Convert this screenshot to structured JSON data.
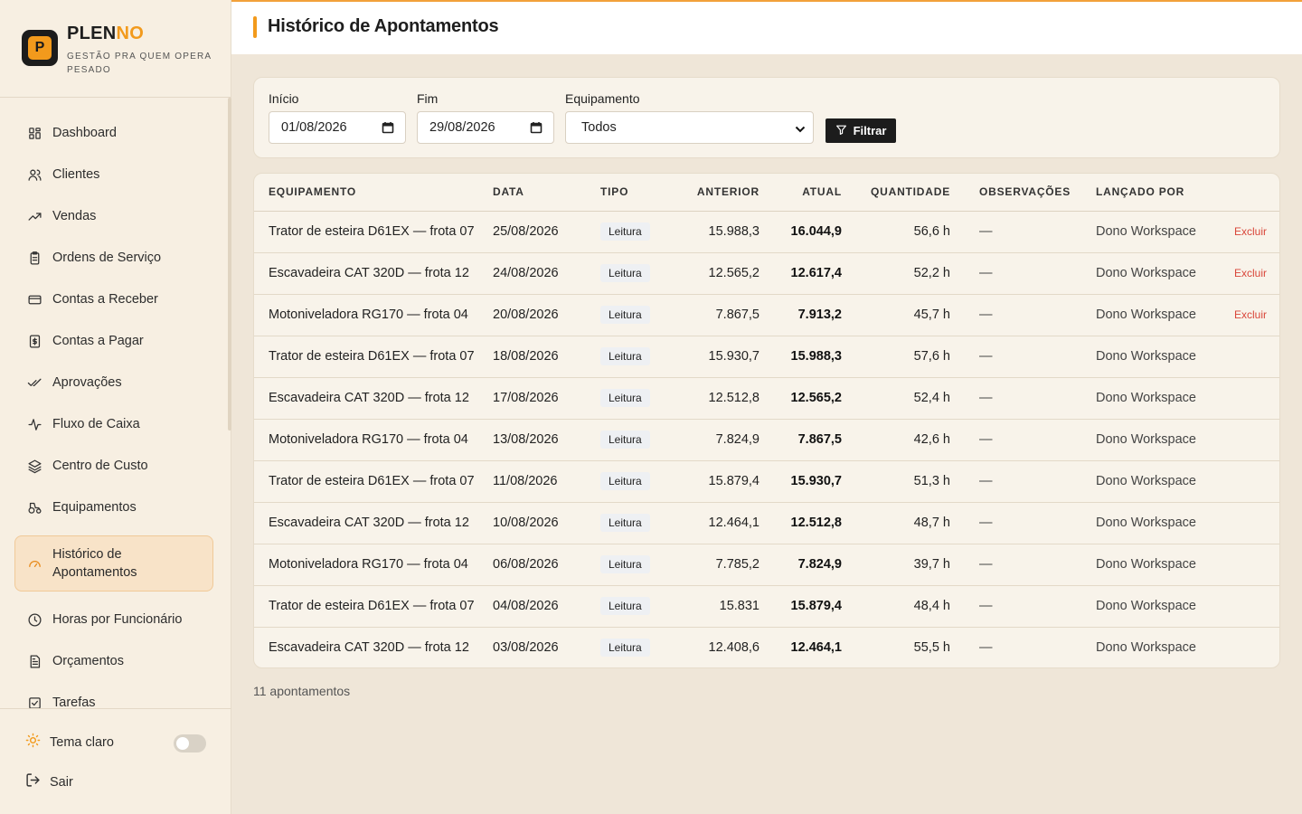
{
  "brand": {
    "logo_letter": "P",
    "name_a": "PLEN",
    "name_b": "NO",
    "tagline": "GESTÃO PRA QUEM OPERA PESADO"
  },
  "nav": [
    {
      "label": "Dashboard",
      "icon": "grid-icon"
    },
    {
      "label": "Clientes",
      "icon": "users-icon"
    },
    {
      "label": "Vendas",
      "icon": "trending-up-icon"
    },
    {
      "label": "Ordens de Serviço",
      "icon": "clipboard-icon"
    },
    {
      "label": "Contas a Receber",
      "icon": "credit-card-icon"
    },
    {
      "label": "Contas a Pagar",
      "icon": "receipt-icon"
    },
    {
      "label": "Aprovações",
      "icon": "check-double-icon"
    },
    {
      "label": "Fluxo de Caixa",
      "icon": "activity-icon"
    },
    {
      "label": "Centro de Custo",
      "icon": "layers-icon"
    },
    {
      "label": "Equipamentos",
      "icon": "tractor-icon"
    },
    {
      "label": "Histórico de Apontamentos",
      "icon": "gauge-icon",
      "active": true
    },
    {
      "label": "Horas por Funcionário",
      "icon": "clock-icon"
    },
    {
      "label": "Orçamentos",
      "icon": "file-text-icon"
    },
    {
      "label": "Tarefas",
      "icon": "check-square-icon"
    }
  ],
  "footer": {
    "theme_label": "Tema claro",
    "logout_label": "Sair"
  },
  "page": {
    "title": "Histórico de Apontamentos"
  },
  "filters": {
    "start_label": "Início",
    "start_value": "01/08/2026",
    "end_label": "Fim",
    "end_value": "29/08/2026",
    "equipment_label": "Equipamento",
    "equipment_value": "Todos",
    "filter_button": "Filtrar"
  },
  "table": {
    "headers": [
      "EQUIPAMENTO",
      "DATA",
      "TIPO",
      "ANTERIOR",
      "ATUAL",
      "QUANTIDADE",
      "OBSERVAÇÕES",
      "LANÇADO POR"
    ],
    "rows": [
      {
        "equipamento": "Trator de esteira D61EX — frota 07",
        "data": "25/08/2026",
        "tipo": "Leitura",
        "anterior": "15.988,3",
        "atual": "16.044,9",
        "quantidade": "56,6 h",
        "obs": "—",
        "por": "Dono Workspace",
        "acao": "Excluir"
      },
      {
        "equipamento": "Escavadeira CAT 320D — frota 12",
        "data": "24/08/2026",
        "tipo": "Leitura",
        "anterior": "12.565,2",
        "atual": "12.617,4",
        "quantidade": "52,2 h",
        "obs": "—",
        "por": "Dono Workspace",
        "acao": "Excluir"
      },
      {
        "equipamento": "Motoniveladora RG170 — frota 04",
        "data": "20/08/2026",
        "tipo": "Leitura",
        "anterior": "7.867,5",
        "atual": "7.913,2",
        "quantidade": "45,7 h",
        "obs": "—",
        "por": "Dono Workspace",
        "acao": "Excluir"
      },
      {
        "equipamento": "Trator de esteira D61EX — frota 07",
        "data": "18/08/2026",
        "tipo": "Leitura",
        "anterior": "15.930,7",
        "atual": "15.988,3",
        "quantidade": "57,6 h",
        "obs": "—",
        "por": "Dono Workspace",
        "acao": ""
      },
      {
        "equipamento": "Escavadeira CAT 320D — frota 12",
        "data": "17/08/2026",
        "tipo": "Leitura",
        "anterior": "12.512,8",
        "atual": "12.565,2",
        "quantidade": "52,4 h",
        "obs": "—",
        "por": "Dono Workspace",
        "acao": ""
      },
      {
        "equipamento": "Motoniveladora RG170 — frota 04",
        "data": "13/08/2026",
        "tipo": "Leitura",
        "anterior": "7.824,9",
        "atual": "7.867,5",
        "quantidade": "42,6 h",
        "obs": "—",
        "por": "Dono Workspace",
        "acao": ""
      },
      {
        "equipamento": "Trator de esteira D61EX — frota 07",
        "data": "11/08/2026",
        "tipo": "Leitura",
        "anterior": "15.879,4",
        "atual": "15.930,7",
        "quantidade": "51,3 h",
        "obs": "—",
        "por": "Dono Workspace",
        "acao": ""
      },
      {
        "equipamento": "Escavadeira CAT 320D — frota 12",
        "data": "10/08/2026",
        "tipo": "Leitura",
        "anterior": "12.464,1",
        "atual": "12.512,8",
        "quantidade": "48,7 h",
        "obs": "—",
        "por": "Dono Workspace",
        "acao": ""
      },
      {
        "equipamento": "Motoniveladora RG170 — frota 04",
        "data": "06/08/2026",
        "tipo": "Leitura",
        "anterior": "7.785,2",
        "atual": "7.824,9",
        "quantidade": "39,7 h",
        "obs": "—",
        "por": "Dono Workspace",
        "acao": ""
      },
      {
        "equipamento": "Trator de esteira D61EX — frota 07",
        "data": "04/08/2026",
        "tipo": "Leitura",
        "anterior": "15.831",
        "atual": "15.879,4",
        "quantidade": "48,4 h",
        "obs": "—",
        "por": "Dono Workspace",
        "acao": ""
      },
      {
        "equipamento": "Escavadeira CAT 320D — frota 12",
        "data": "03/08/2026",
        "tipo": "Leitura",
        "anterior": "12.408,6",
        "atual": "12.464,1",
        "quantidade": "55,5 h",
        "obs": "—",
        "por": "Dono Workspace",
        "acao": ""
      }
    ],
    "count_label": "11 apontamentos"
  },
  "colors": {
    "accent": "#f29a1c",
    "danger": "#d9463a",
    "sidebar_bg": "#f7efe2",
    "page_bg": "#efe6d8"
  }
}
